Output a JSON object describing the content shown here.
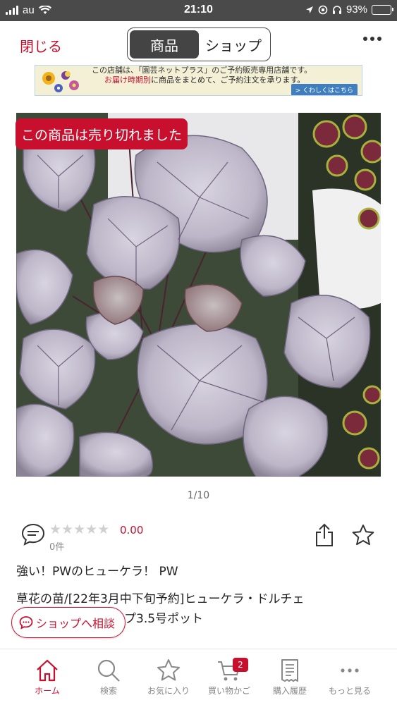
{
  "status_bar": {
    "carrier": "au",
    "time": "21:10",
    "battery": "93%",
    "battery_level": 0.93
  },
  "topbar": {
    "close_label": "閉じる",
    "tabs": [
      {
        "label": "商品",
        "active": true
      },
      {
        "label": "ショップ",
        "active": false
      }
    ]
  },
  "banner": {
    "line1": "この店舗は、「園芸ネットプラス」のご予約販売専用店舗です。",
    "line2_highlight": "お届け時期別",
    "line2_rest": "に商品をまとめて、ご予約注文を承ります。",
    "button": "くわしくはこちら"
  },
  "product": {
    "soldout_label": "この商品は売り切れました",
    "image_counter": "1/10",
    "rating_score": "0.00",
    "stars_filled": 0,
    "stars_total": 5,
    "review_count": "0件",
    "title_line1": "強い！PWのヒューケラ！ PW",
    "title_line2": "草花の苗/[22年3月中下旬予約]ヒューケラ・ドルチェ",
    "title_line3": "シルバーガムドロップ3.5号ポット"
  },
  "consult_button": {
    "label": "ショップへ相談"
  },
  "tabbar": {
    "items": [
      {
        "label": "ホーム",
        "icon": "home-icon",
        "active": true
      },
      {
        "label": "検索",
        "icon": "search-icon",
        "active": false
      },
      {
        "label": "お気に入り",
        "icon": "star-icon",
        "active": false
      },
      {
        "label": "買い物かご",
        "icon": "cart-icon",
        "active": false,
        "badge": "2"
      },
      {
        "label": "購入履歴",
        "icon": "receipt-icon",
        "active": false
      },
      {
        "label": "もっと見る",
        "icon": "more-icon",
        "active": false
      }
    ]
  },
  "colors": {
    "accent": "#c8102e",
    "status_bar": "#4a4a4a",
    "segment_active": "#444444"
  }
}
